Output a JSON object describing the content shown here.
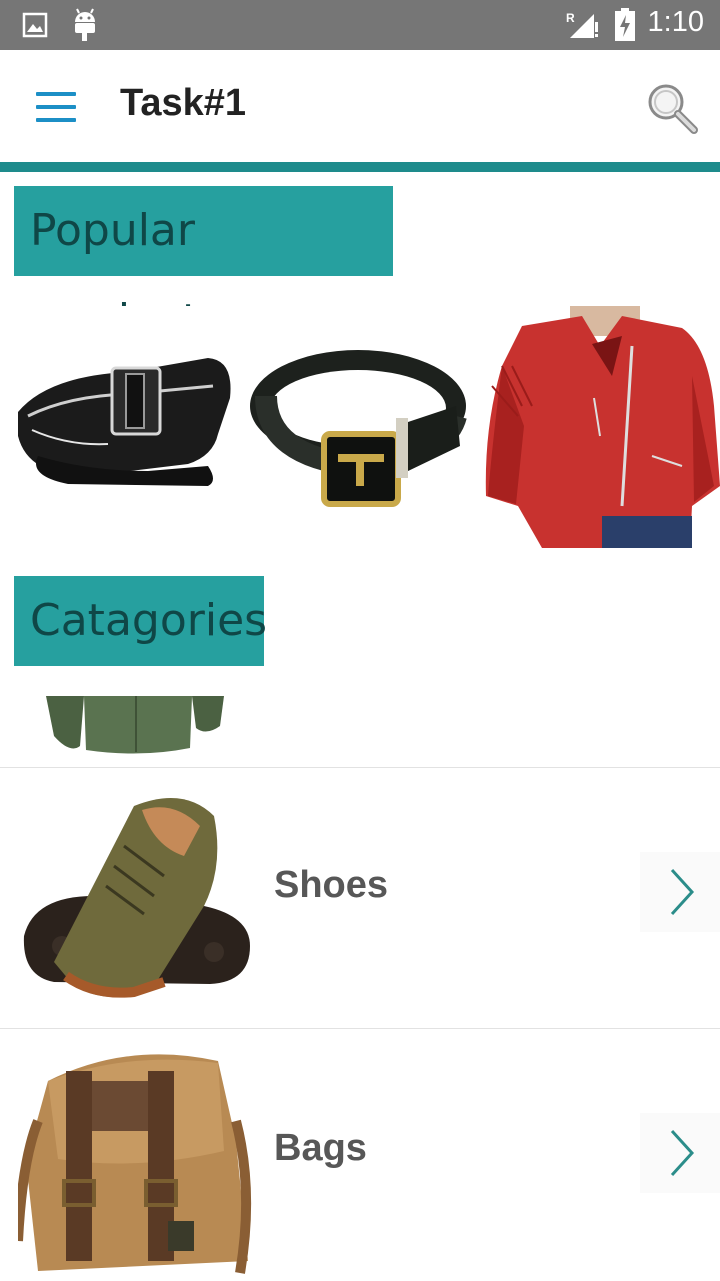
{
  "status_bar": {
    "time": "1:10",
    "icons": [
      "image-icon",
      "android-icon",
      "signal-icon",
      "battery-charging-icon"
    ]
  },
  "app_bar": {
    "title": "Task#1",
    "menu_icon": "menu-icon",
    "search_icon": "search-icon"
  },
  "colors": {
    "accent_teal": "#26a09f",
    "accent_line": "#1e8b8c",
    "status_gray": "#767676",
    "menu_blue": "#1c8fc6"
  },
  "popular_products": {
    "heading": "Popular products",
    "items": [
      "belt-image",
      "belt-with-buckle-image",
      "red-leather-jacket-image"
    ]
  },
  "categories": {
    "heading": "Catagories",
    "items": [
      {
        "label": "Shoes",
        "icon": "shoe-image"
      },
      {
        "label": "Bags",
        "icon": "bag-image"
      }
    ]
  }
}
